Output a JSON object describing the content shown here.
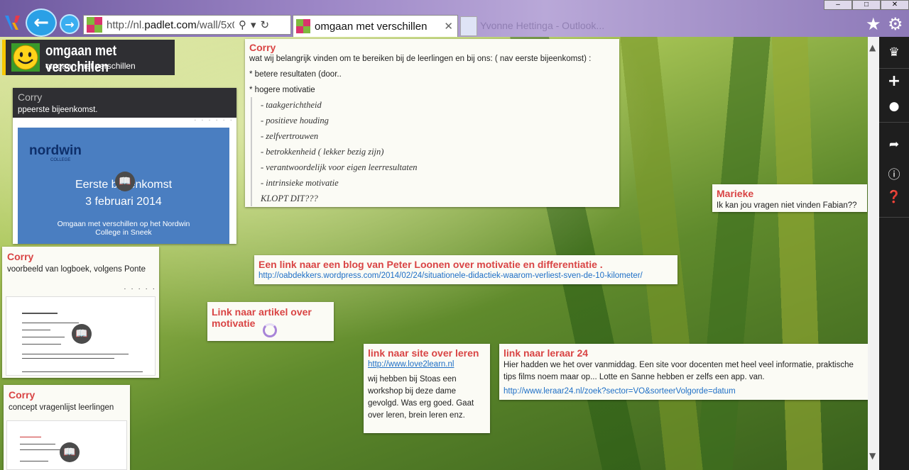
{
  "browser": {
    "address_url_domain": "http://nl.",
    "address_url_host": "padlet.com",
    "address_url_path": "/wall/5x0",
    "active_tab_title": "omgaan met verschillen",
    "inactive_tab_title": "Yvonne Hettinga - Outlook..."
  },
  "header": {
    "title": "omgaan met verschillen",
    "subtitle": "omgaan met verschillen"
  },
  "posts": {
    "p1": {
      "author": "Corry",
      "body": "ppeerste bijeenkomst.",
      "slide_brand": "nordwin",
      "slide_brand_sub": "COLLEGE",
      "slide_title": "Eerste bijeenkomst",
      "slide_date": "3 februari 2014",
      "slide_caption": "Omgaan met verschillen op het Nordwin College in Sneek"
    },
    "p2": {
      "author": "Corry",
      "intro": "wat wij belangrijk vinden om te bereiken bij de leerlingen en bij ons: ( nav eerste bijeenkomst) :",
      "bullet1": "* betere resultaten (door..",
      "bullet2": "*  hogere motivatie",
      "items": [
        "- taakgerichtheid",
        "- positieve houding",
        "- zelfvertrouwen",
        "- betrokkenheid ( lekker bezig zijn)",
        "- verantwoordelijk voor eigen leerresultaten",
        "- intrinsieke motivatie",
        "KLOPT DIT???"
      ]
    },
    "p3": {
      "author": "Corry",
      "body": "voorbeeld van logboek, volgens Ponte"
    },
    "p4": {
      "title": "Link naar artikel over motivatie"
    },
    "p5": {
      "title": "Een link naar een blog van Peter Loonen over motivatie en differentiatie .",
      "url": "http://oabdekkers.wordpress.com/2014/02/24/situationele-didactiek-waarom-verliest-sven-de-10-kilometer/"
    },
    "p6": {
      "author": "Marieke",
      "body": "Ik kan jou vragen niet vinden Fabian??"
    },
    "p7": {
      "author": "Corry",
      "body": "concept vragenlijst leerlingen"
    },
    "p8": {
      "title": "link naar site over leren",
      "url": "http://www.love2learn.nl",
      "body": "wij hebben bij Stoas een workshop bij deze dame gevolgd. Was erg goed. Gaat over leren, brein leren enz."
    },
    "p9": {
      "title": "link naar leraar 24",
      "body": "Hier hadden we het over vanmiddag. Een site voor docenten met heel veel informatie, praktische tips films noem maar op... Lotte en Sanne hebben er zelfs een app. van.",
      "url": "http://www.leraar24.nl/zoek?sector=VO&sorteerVolgorde=datum"
    }
  },
  "icons": {
    "back": "back-arrow-icon",
    "forward": "forward-arrow-icon",
    "search": "search-icon",
    "refresh": "refresh-icon",
    "close": "close-icon",
    "star": "favorites-star-icon",
    "gear": "settings-gear-icon",
    "book": "book-icon",
    "crown": "padlet-crown-icon",
    "add": "add-icon",
    "user": "user-icon",
    "share": "share-icon",
    "info": "info-icon",
    "help": "help-icon"
  },
  "colors": {
    "accent_red": "#d94444",
    "link_blue": "#1e6fc6",
    "header_bg": "#2f2f33",
    "header_accent": "#f6c800",
    "sidebar_bg": "#1e1e1e",
    "slide_blue": "#4a7ec1"
  }
}
